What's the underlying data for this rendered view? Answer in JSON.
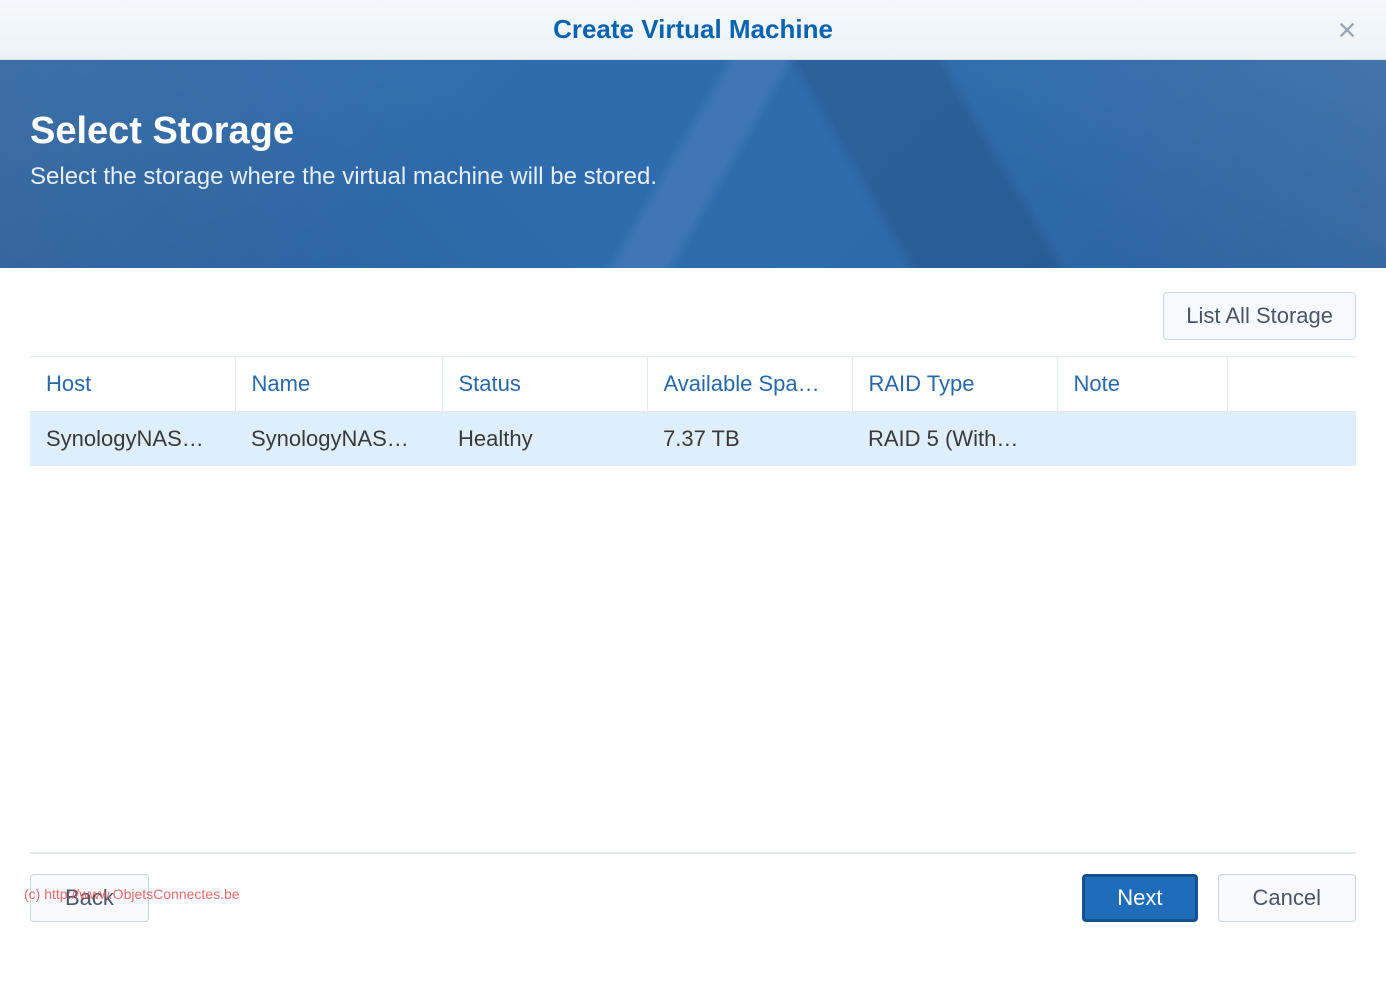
{
  "dialog": {
    "title": "Create Virtual Machine"
  },
  "banner": {
    "title": "Select Storage",
    "subtitle": "Select the storage where the virtual machine will be stored."
  },
  "actions": {
    "list_all_storage_label": "List All Storage"
  },
  "table": {
    "columns": {
      "host": "Host",
      "name": "Name",
      "status": "Status",
      "available_space": "Available Spa…",
      "raid_type": "RAID Type",
      "note": "Note"
    },
    "rows": [
      {
        "host": "SynologyNAS…",
        "name": "SynologyNAS…",
        "status": "Healthy",
        "available_space": "7.37 TB",
        "raid_type": "RAID 5 (With…",
        "note": ""
      }
    ]
  },
  "footer": {
    "back_label": "Back",
    "next_label": "Next",
    "cancel_label": "Cancel"
  },
  "watermark": "(c) http://www.ObjetsConnectes.be"
}
